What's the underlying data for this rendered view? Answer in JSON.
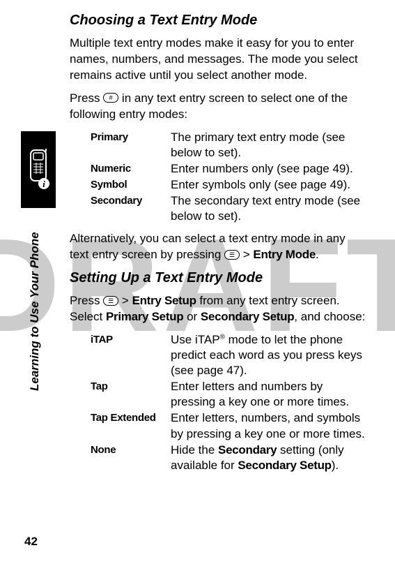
{
  "watermark": "DRAFT",
  "sidebar_label": "Learning to Use Your Phone",
  "page_number": "42",
  "section1": {
    "title": "Choosing a Text Entry Mode",
    "p1": "Multiple text entry modes make it easy for you to enter names, numbers, and messages. The mode you select remains active until you select another mode.",
    "p2a": "Press ",
    "p2b": " in any text entry screen to select one of the following entry modes:",
    "rows": [
      {
        "term": "Primary",
        "desc": "The primary text entry mode (see below to set)."
      },
      {
        "term": "Numeric",
        "desc": "Enter numbers only (see page 49)."
      },
      {
        "term": "Symbol",
        "desc": "Enter symbols only (see page 49)."
      },
      {
        "term": "Secondary",
        "desc": "The secondary text entry mode (see below to set)."
      }
    ],
    "p3a": "Alternatively, you can select a text entry mode in any text entry screen by pressing ",
    "p3b": " > ",
    "p3c": "Entry Mode",
    "p3d": "."
  },
  "section2": {
    "title": "Setting Up a Text Entry Mode",
    "p1a": "Press ",
    "p1b": " > ",
    "p1c": "Entry Setup",
    "p1d": " from any text entry screen. Select ",
    "p1e": "Primary Setup",
    "p1f": " or ",
    "p1g": "Secondary Setup",
    "p1h": ", and choose:",
    "rows": [
      {
        "term": "iTAP",
        "desc_a": "Use iTAP",
        "desc_b": " mode to let the phone predict each word as you press keys (see page 47)."
      },
      {
        "term": "Tap",
        "desc": "Enter letters and numbers by pressing a key one or more times."
      },
      {
        "term": "Tap Extended",
        "desc": "Enter letters, numbers, and symbols by pressing a key one or more times."
      },
      {
        "term": "None",
        "desc_a": "Hide the ",
        "desc_b": "Secondary",
        "desc_c": " setting (only available for ",
        "desc_d": "Secondary Setup",
        "desc_e": ")."
      }
    ]
  }
}
